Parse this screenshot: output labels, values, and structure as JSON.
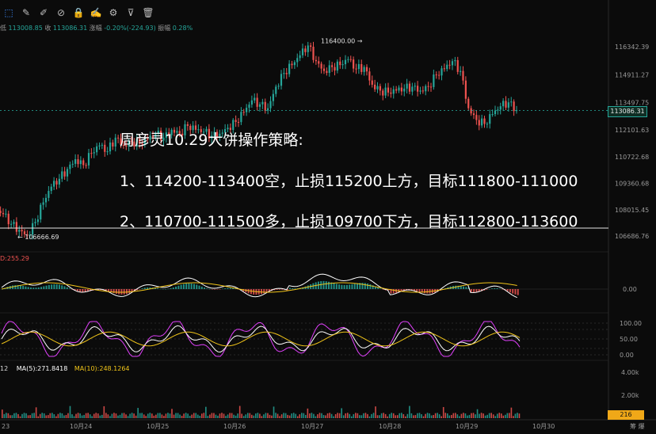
{
  "toolbar": {
    "items": [
      {
        "name": "select-icon",
        "glyph": "⬚"
      },
      {
        "name": "pencil-icon",
        "glyph": "✎"
      },
      {
        "name": "brush-icon",
        "glyph": "✐"
      },
      {
        "name": "eye-off-icon",
        "glyph": "⊘"
      },
      {
        "name": "lock-icon",
        "glyph": "🔒"
      },
      {
        "name": "edit-note-icon",
        "glyph": "✍"
      },
      {
        "name": "settings-icon",
        "glyph": "⚙"
      },
      {
        "name": "filter-icon",
        "glyph": "⊽"
      },
      {
        "name": "trash-icon",
        "glyph": "🗑"
      }
    ]
  },
  "ohlc": {
    "low_label": "低",
    "low_value": "113008.85",
    "close_label": "收",
    "close_value": "113086.31",
    "change_label": "涨幅",
    "change_value": "-0.20%(-224.93)",
    "amplitude_label": "振幅",
    "amplitude_value": "0.28%"
  },
  "overlay": {
    "title": "周彦灵10.29大饼操作策略:",
    "line1": "1、114200-113400空，止损115200上方，目标111800-111000",
    "line2": "2、110700-111500多，止损109700下方，目标112800-113600"
  },
  "annotations": {
    "high_marker": "116400.00 →",
    "low_marker": "← 106666.69"
  },
  "price_badge": "113086.31",
  "macd_label": "D:255.29",
  "volume": {
    "prefix": "12",
    "ma5": "MA(5):271.8418",
    "ma10": "MA(10):248.1264",
    "badge": "216"
  },
  "bottom_right": "筹  爆",
  "colors": {
    "up": "#26a69a",
    "down": "#ef5350",
    "ma_yellow": "#f0c419",
    "ma_white": "#ffffff",
    "kdj_purple": "#e040fb",
    "accent": "#3d8cff"
  },
  "chart_data": {
    "type": "candlestick",
    "x_tick_labels": [
      "23",
      "10月24",
      "10月25",
      "10月26",
      "10月27",
      "10月28",
      "10月29",
      "10月30"
    ],
    "price_axis_labels": [
      "116342.39",
      "114911.27",
      "113497.75",
      "112101.63",
      "110722.68",
      "109360.68",
      "108015.45",
      "106686.76"
    ],
    "macd_axis_labels": [
      "0.00"
    ],
    "kdj_axis_labels": [
      "100.00",
      "50.00",
      "0.00"
    ],
    "volume_axis_labels": [
      "4.00k",
      "2.00k"
    ],
    "price_range": [
      106400,
      116700
    ],
    "close_path": [
      107800,
      107300,
      107000,
      106700,
      107400,
      108400,
      109200,
      109600,
      110100,
      110600,
      110300,
      110900,
      111300,
      111000,
      111700,
      111300,
      111500,
      111400,
      111600,
      111900,
      111700,
      112100,
      111900,
      112300,
      112100,
      112000,
      111800,
      111900,
      112200,
      112500,
      113000,
      113600,
      113400,
      113200,
      114300,
      115000,
      115400,
      115900,
      116400,
      115600,
      115100,
      115300,
      115400,
      115700,
      115200,
      115300,
      114400,
      114100,
      114000,
      114100,
      114200,
      114300,
      114100,
      114300,
      114900,
      115200,
      115600,
      115100,
      113200,
      112600,
      112400,
      112900,
      113300,
      113500,
      113100
    ],
    "high_point": 116400.0,
    "low_point": 106666.69,
    "last_price": 113086.31
  }
}
